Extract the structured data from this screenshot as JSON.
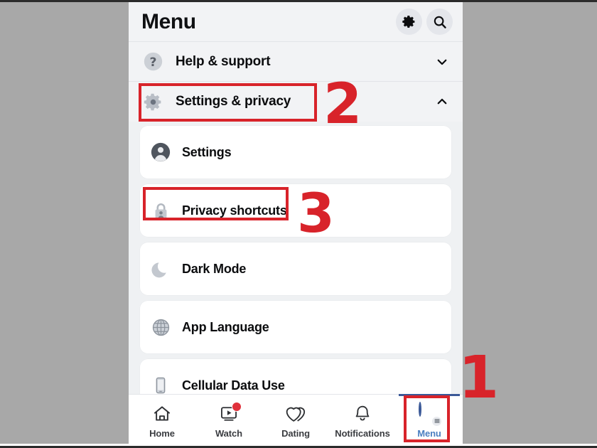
{
  "header": {
    "title": "Menu",
    "settings_icon": "gear-icon",
    "search_icon": "search-icon"
  },
  "sections": [
    {
      "id": "help-support",
      "label": "Help & support",
      "icon": "question-mark-circle-icon",
      "chevron": "chevron-down-icon",
      "expanded": false
    },
    {
      "id": "settings-privacy",
      "label": "Settings & privacy",
      "icon": "gear-icon",
      "chevron": "chevron-up-icon",
      "expanded": true
    }
  ],
  "menu_items": [
    {
      "id": "settings",
      "label": "Settings",
      "icon": "person-circle-icon"
    },
    {
      "id": "privacy-shortcuts",
      "label": "Privacy shortcuts",
      "icon": "lock-person-icon"
    },
    {
      "id": "dark-mode",
      "label": "Dark Mode",
      "icon": "moon-icon"
    },
    {
      "id": "app-language",
      "label": "App Language",
      "icon": "globe-icon"
    },
    {
      "id": "cellular-data-use",
      "label": "Cellular Data Use",
      "icon": "phone-icon"
    }
  ],
  "bottom_nav": {
    "items": [
      {
        "id": "home",
        "label": "Home",
        "icon": "home-icon",
        "active": false,
        "badge": false
      },
      {
        "id": "watch",
        "label": "Watch",
        "icon": "watch-video-icon",
        "active": false,
        "badge": true
      },
      {
        "id": "dating",
        "label": "Dating",
        "icon": "double-heart-icon",
        "active": false,
        "badge": false
      },
      {
        "id": "notifications",
        "label": "Notifications",
        "icon": "bell-icon",
        "active": false,
        "badge": false
      },
      {
        "id": "menu",
        "label": "Menu",
        "icon": "avatar-hamburger-icon",
        "active": true,
        "badge": false
      }
    ]
  },
  "annotations": {
    "step_1": "1",
    "step_2": "2",
    "step_3": "3",
    "color": "#d8232a"
  },
  "colors": {
    "page_background": "#eff1f3",
    "card_background": "#ffffff",
    "header_background": "#f2f3f5",
    "backdrop": "#a8a8a8",
    "accent_blue": "#3b5998",
    "active_label": "#4a7fc1",
    "badge_red": "#e0313b",
    "annotation_red": "#d8232a"
  }
}
